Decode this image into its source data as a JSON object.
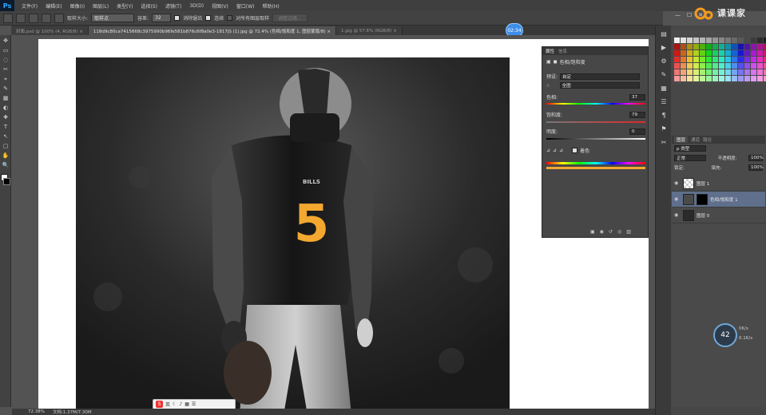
{
  "app": {
    "logo": "Ps"
  },
  "menu": [
    "文件(F)",
    "编辑(E)",
    "图像(I)",
    "图层(L)",
    "类型(Y)",
    "选择(S)",
    "滤镜(T)",
    "3D(D)",
    "视图(V)",
    "窗口(W)",
    "帮助(H)"
  ],
  "window_controls": [
    "—",
    "☐",
    "✕"
  ],
  "options": {
    "sample_size_label": "取样大小:",
    "sample_size_value": "取样点",
    "tolerance_label": "容差:",
    "tolerance_value": "32",
    "antialias_label": "消除锯齿",
    "contiguous_label": "连续",
    "all_layers_label": "对所有图层取样",
    "refine_edge_label": "调整边缘..."
  },
  "brand": {
    "name": "课课家",
    "accent": "#f39a1e"
  },
  "timer": "02:34",
  "tabs": [
    {
      "label": "封面.psd @ 100% (4, RGB/8) ×",
      "active": false
    },
    {
      "label": "118d9c80ca7415668c3975990b96fe581b876c6f8a0e3-1817jS (1).jpg @ 72.4% (色相/饱和度 1, 图层蒙版/8) ×",
      "active": true
    },
    {
      "label": "1.jpg @ 57.6% (RGB/8) ×",
      "active": false
    }
  ],
  "tools": [
    "✥",
    "▭",
    "◌",
    "✂",
    "⌖",
    "✎",
    "▦",
    "◐",
    "✚",
    "T",
    "↖",
    "▢",
    "✋",
    "🔍"
  ],
  "rail_icons": [
    "▤",
    "▶",
    "⚙",
    "✎",
    "▦",
    "☰",
    "¶",
    "⚑",
    "✂"
  ],
  "properties": {
    "tab_properties": "属性",
    "tab_info": "信息",
    "panel_title": "色相/饱和度",
    "preset_label": "预设:",
    "preset_value": "自定",
    "channel_value": "全图",
    "hue_label": "色相:",
    "hue_value": "37",
    "saturation_label": "饱和度:",
    "saturation_value": "79",
    "lightness_label": "明度:",
    "lightness_value": "0",
    "colorize_label": "着色"
  },
  "layers": {
    "tabs": [
      "图层",
      "通道",
      "路径"
    ],
    "kind_label": "p 类型",
    "blend_mode": "正常",
    "opacity_label": "不透明度:",
    "opacity_value": "100%",
    "lock_label": "锁定:",
    "fill_label": "填充:",
    "fill_value": "100%",
    "items": [
      {
        "name": "图层 1",
        "selected": false
      },
      {
        "name": "色相/饱和度 1",
        "selected": true
      },
      {
        "name": "图层 0",
        "selected": false
      }
    ]
  },
  "status": {
    "zoom": "72.38%",
    "doc_size": "文档:1.37M/7.30M"
  },
  "ime": {
    "label": "英"
  },
  "speed": {
    "percent": "42",
    "up": "0K/s",
    "down": "0.1K/s"
  },
  "jersey": {
    "team": "BILLS",
    "number": "5"
  }
}
